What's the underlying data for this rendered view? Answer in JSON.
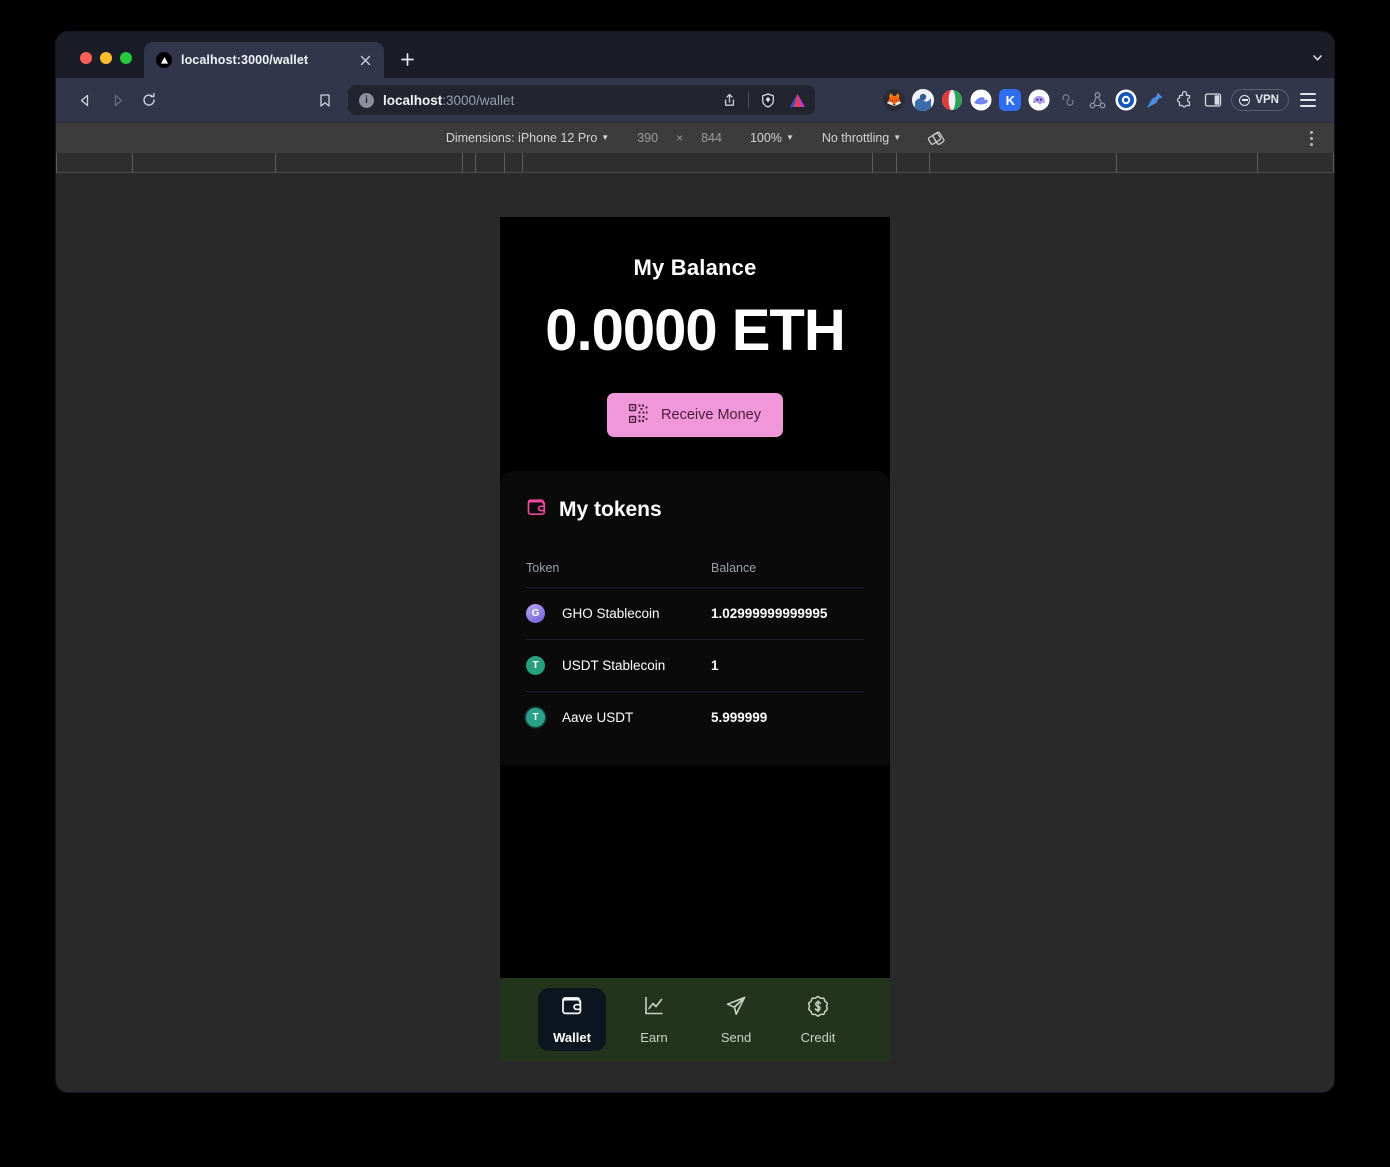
{
  "browser": {
    "tab": {
      "title": "localhost:3000/wallet",
      "favicon": "nextjs-triangle-icon"
    },
    "new_tab_label": "+",
    "tabstrip_chevron": "chevron-down-icon",
    "nav": {
      "back": "back-arrow-icon",
      "forward": "forward-arrow-icon",
      "reload": "reload-icon",
      "bookmark": "bookmark-icon"
    },
    "omnibox": {
      "host": "localhost",
      "path": ":3000/wallet",
      "full_url": "localhost:3000/wallet",
      "info_icon": "site-info-icon",
      "share_icon": "share-icon",
      "shield_icon": "brave-shield-icon",
      "app_icon": "aave-triangle-icon"
    },
    "extensions": [
      {
        "name": "metamask-extension-icon",
        "glyph": "🦊",
        "bg": "#2b2b33"
      },
      {
        "name": "wallet-extension-icon",
        "glyph": "",
        "bg": "#eef2f7"
      },
      {
        "name": "color-circle-extension-icon",
        "glyph": "",
        "bg": "#ffffff"
      },
      {
        "name": "rabby-extension-icon",
        "glyph": "",
        "bg": "#ffffff"
      },
      {
        "name": "keplr-extension-icon",
        "glyph": "K",
        "bg": "#2f6ef0"
      },
      {
        "name": "phantom-extension-icon",
        "glyph": "",
        "bg": "#ffffff"
      },
      {
        "name": "infinity-extension-icon",
        "glyph": "∞",
        "bg": "transparent"
      },
      {
        "name": "graph-extension-icon",
        "glyph": "",
        "bg": "transparent"
      },
      {
        "name": "target-extension-icon",
        "glyph": "",
        "bg": "#ffffff"
      },
      {
        "name": "pin-extension-icon",
        "glyph": "",
        "bg": "transparent"
      },
      {
        "name": "puzzle-extensions-icon",
        "glyph": "",
        "bg": "transparent"
      },
      {
        "name": "side-panel-icon",
        "glyph": "",
        "bg": "transparent"
      }
    ],
    "vpn": {
      "label": "VPN",
      "icon": "vpn-icon"
    },
    "menu_icon": "hamburger-menu-icon"
  },
  "device_toolbar": {
    "dimensions_label": "Dimensions: iPhone 12 Pro",
    "width": "390",
    "times": "×",
    "height": "844",
    "zoom": "100%",
    "throttling": "No throttling",
    "rotate_icon": "rotate-device-icon",
    "more_icon": "more-options-icon"
  },
  "app": {
    "balance": {
      "title": "My Balance",
      "amount": "0.0000 ETH",
      "receive_button": {
        "label": "Receive Money",
        "icon": "qr-code-icon",
        "bg": "#ef97d9",
        "text_color": "#4a1b3c"
      }
    },
    "tokens": {
      "title": "My tokens",
      "icon": "wallet-icon",
      "icon_color": "#ec4899",
      "columns": {
        "token": "Token",
        "balance": "Balance"
      },
      "rows": [
        {
          "icon_name": "gho-token-icon",
          "symbol": "G",
          "icon_bg": "#8b7ae8",
          "name": "GHO Stablecoin",
          "balance": "1.02999999999995"
        },
        {
          "icon_name": "usdt-token-icon",
          "symbol": "T",
          "icon_bg": "#26a17b",
          "name": "USDT Stablecoin",
          "balance": "1"
        },
        {
          "icon_name": "aave-usdt-token-icon",
          "symbol": "T",
          "icon_bg": "#1f7a66",
          "name": "Aave USDT",
          "balance": "5.999999"
        }
      ]
    },
    "bottom_nav": {
      "bg": "#23341d",
      "items": [
        {
          "label": "Wallet",
          "icon": "wallet-icon",
          "active": true
        },
        {
          "label": "Earn",
          "icon": "chart-line-icon",
          "active": false
        },
        {
          "label": "Send",
          "icon": "paper-plane-icon",
          "active": false
        },
        {
          "label": "Credit",
          "icon": "dollar-badge-icon",
          "active": false
        }
      ]
    }
  }
}
